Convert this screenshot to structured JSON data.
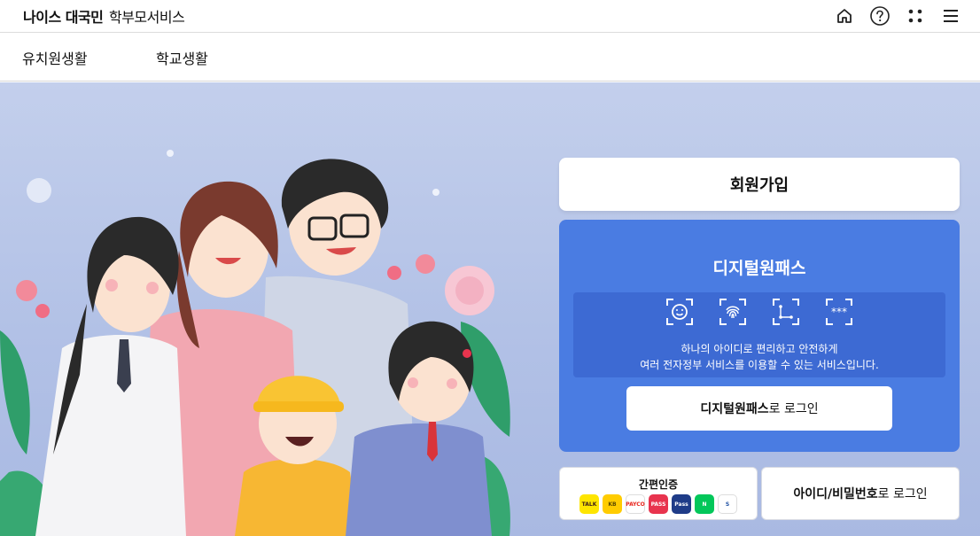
{
  "header": {
    "brand_bold": "나이스 대국민",
    "brand_light": "학부모서비스",
    "tools": [
      {
        "icon": "home-icon"
      },
      {
        "icon": "help-icon"
      },
      {
        "icon": "apps-icon"
      },
      {
        "icon": "menu-icon"
      }
    ]
  },
  "nav": {
    "items": [
      "유치원생활",
      "학교생활"
    ]
  },
  "panel": {
    "join_label": "회원가입",
    "digital_pass": {
      "title": "디지털원패스",
      "icons": [
        "face-recognition-icon",
        "fingerprint-icon",
        "pattern-icon",
        "pin-icon"
      ],
      "desc_line1": "하나의 아이디로 편리하고 안전하게",
      "desc_line2": "여러 전자정부 서비스를 이용할 수 있는 서비스입니다.",
      "login_bold": "디지털원패스",
      "login_rest": "로 로그인"
    },
    "easy_auth": {
      "title": "간편인증",
      "providers": [
        {
          "name": "kakao",
          "label": "TALK",
          "color": "#fee500",
          "text_color": "#3a1d1d"
        },
        {
          "name": "kb",
          "label": "KB",
          "color": "#ffcc00",
          "text_color": "#5a4a00"
        },
        {
          "name": "payco",
          "label": "PAYCO",
          "color": "#ffffff",
          "text_color": "#e8261d"
        },
        {
          "name": "pass",
          "label": "PASS",
          "color": "#e8344e",
          "text_color": "#ffffff"
        },
        {
          "name": "samsung-pass",
          "label": "Pass",
          "color": "#1f3c88",
          "text_color": "#ffffff"
        },
        {
          "name": "naver",
          "label": "N",
          "color": "#03c75a",
          "text_color": "#ffffff"
        },
        {
          "name": "shinhan",
          "label": "S",
          "color": "#ffffff",
          "text_color": "#1e50a2"
        }
      ]
    },
    "id_login_bold": "아이디/비밀번호",
    "id_login_rest": "로 로그인"
  }
}
